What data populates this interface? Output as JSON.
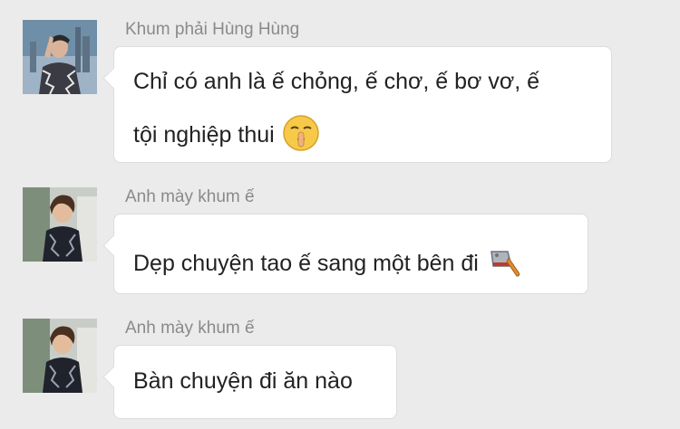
{
  "messages": [
    {
      "sender": "Khum phải Hùng Hùng",
      "lines": [
        "Chỉ có anh là ế chỏng, ế chơ, ế bơ vơ, ế",
        "tội nghiệp thui"
      ],
      "emoji": "shushing-face-icon"
    },
    {
      "sender": "Anh mày khum ế",
      "lines": [
        "Dẹp chuyện tao ế sang một bên đi"
      ],
      "emoji": "cleaver-knife-icon"
    },
    {
      "sender": "Anh mày khum ế",
      "lines": [
        "Bàn chuyện đi ăn nào"
      ]
    }
  ],
  "colors": {
    "background": "#ebebeb",
    "bubble": "#ffffff",
    "bubble_border": "#dcdcdc",
    "sender_text": "#8a8a8a",
    "message_text": "#222222"
  }
}
